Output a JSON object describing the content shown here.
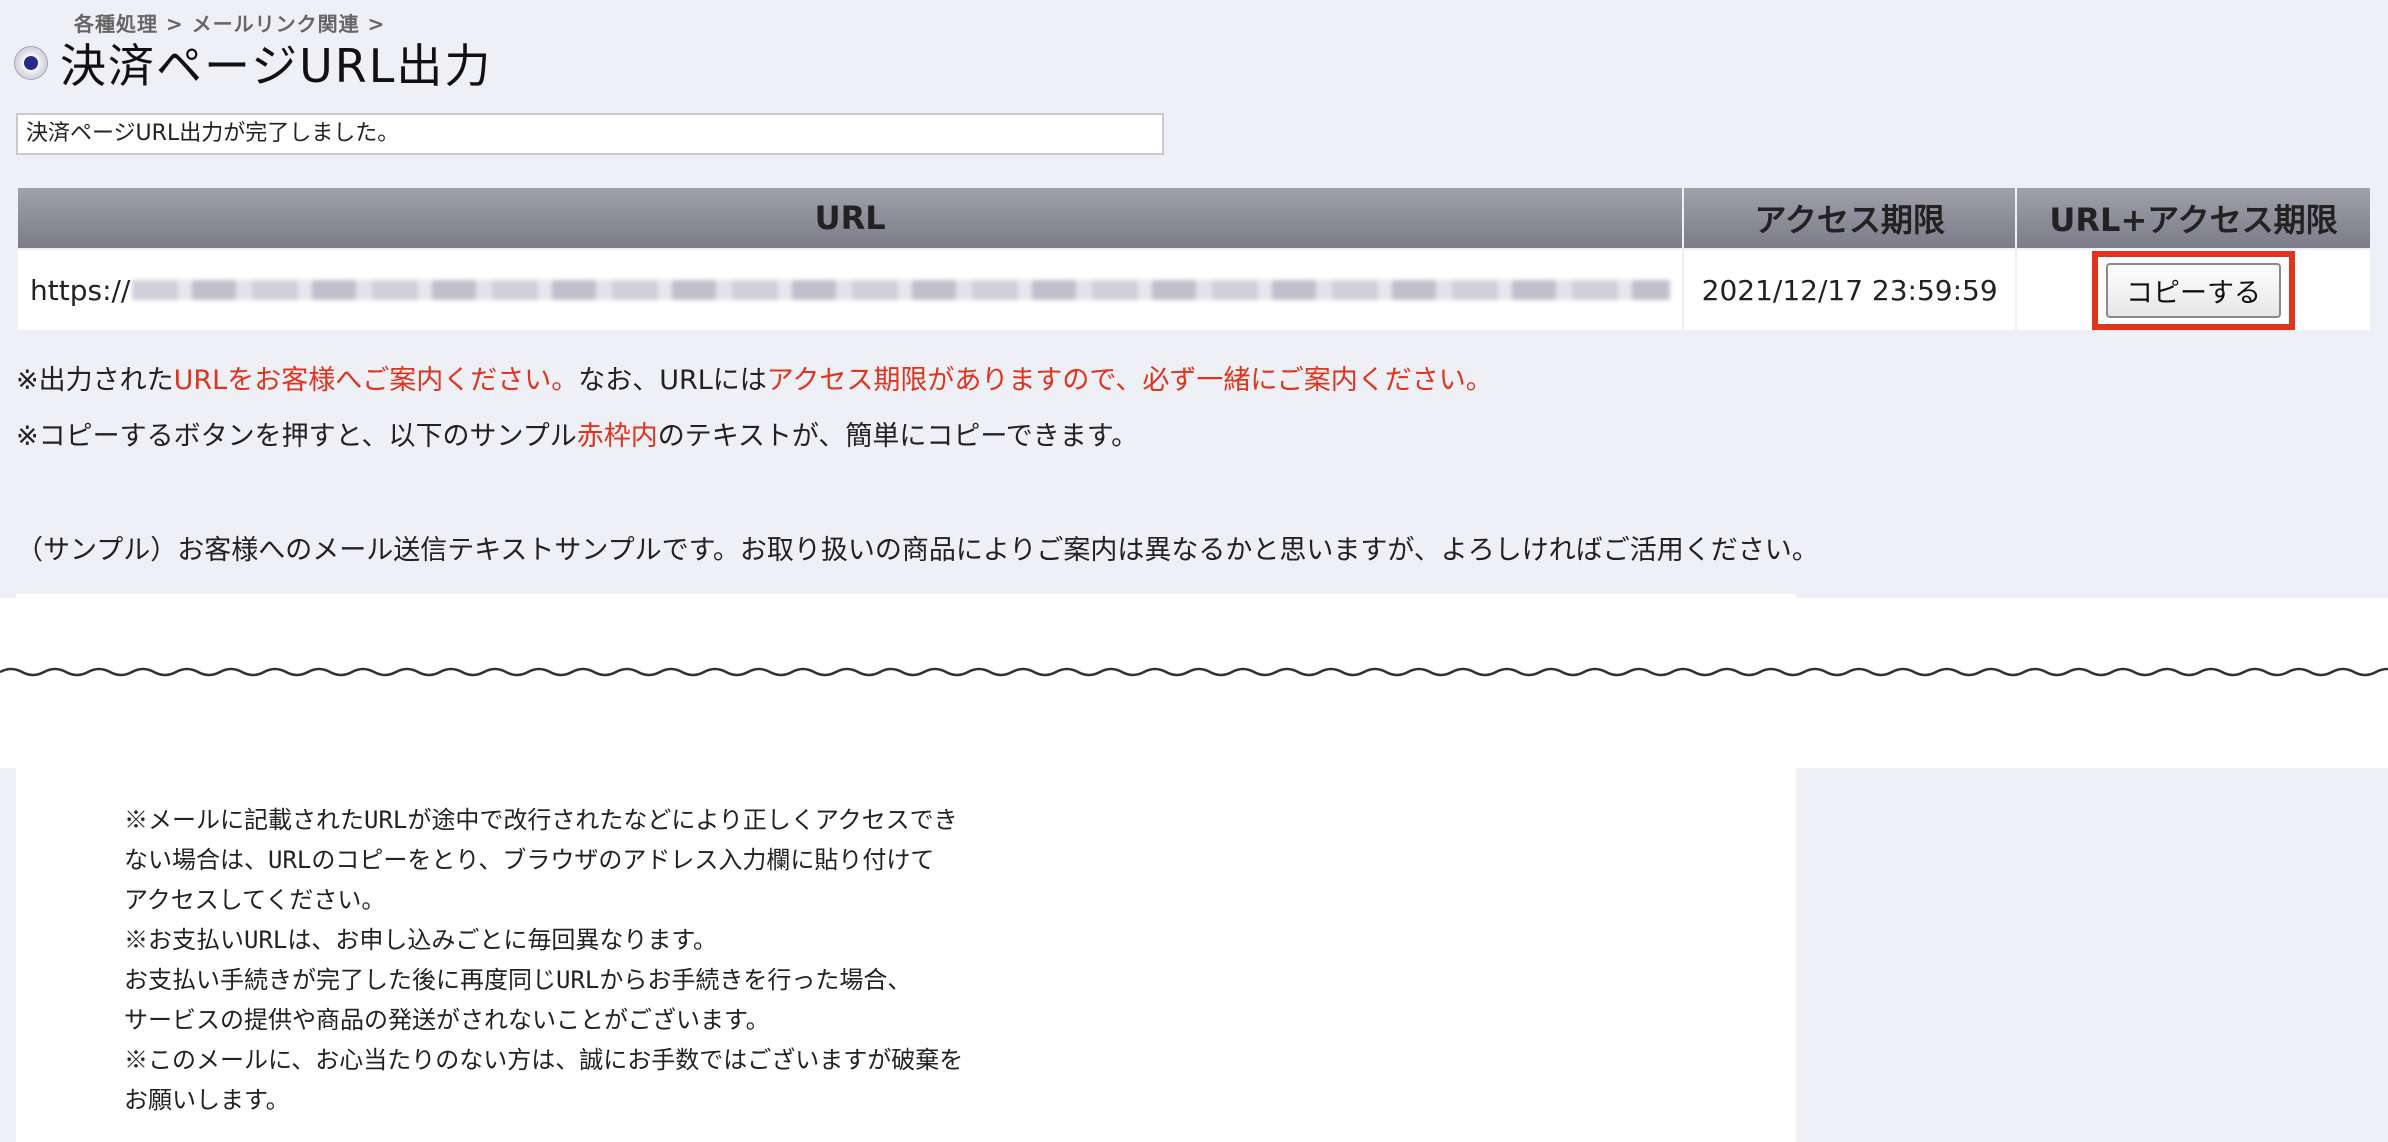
{
  "header": {
    "breadcrumb": "各種処理 > メールリンク関連 >",
    "title": "決済ページURL出力"
  },
  "message": "決済ページURL出力が完了しました。",
  "table": {
    "headers": {
      "url": "URL",
      "expire": "アクセス期限",
      "copy": "URL+アクセス期限"
    },
    "row": {
      "url_prefix": "https://",
      "expire": "2021/12/17 23:59:59",
      "copy_label": "コピーする"
    }
  },
  "notes": {
    "line1": {
      "a": "※出力された",
      "b": "URLをお客様へご案内ください。",
      "c": "なお、URLには",
      "d": "アクセス期限がありますので、必ず一緒にご案内ください。"
    },
    "line2": {
      "a": "※コピーするボタンを押すと、以下のサンプル",
      "b": "赤枠内",
      "c": "のテキストが、簡単にコピーできます。"
    },
    "sample_label": "（サンプル）お客様へのメール送信テキストサンプルです。お取り扱いの商品によりご案内は異なるかと思いますが、よろしければご活用ください。"
  },
  "sample_text": [
    "※メールに記載されたURLが途中で改行されたなどにより正しくアクセスでき",
    "ない場合は、URLのコピーをとり、ブラウザのアドレス入力欄に貼り付けて",
    "アクセスしてください。",
    "※お支払いURLは、お申し込みごとに毎回異なります。",
    "お支払い手続きが完了した後に再度同じURLからお手続きを行った場合、",
    "サービスの提供や商品の発送がされないことがございます。",
    "※このメールに、お心当たりのない方は、誠にお手数ではございますが破棄を",
    "お願いします。"
  ],
  "colors": {
    "highlight": "#e0341e",
    "background": "#efeff6"
  },
  "icons": {
    "title": "radio-bullet-icon",
    "url_value": "blurred-url-redaction"
  }
}
